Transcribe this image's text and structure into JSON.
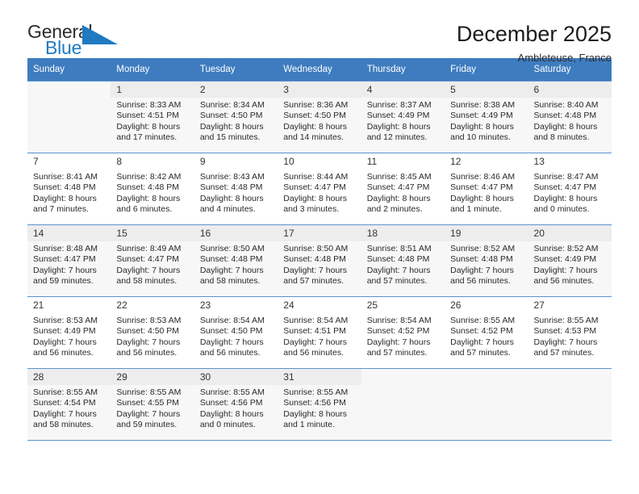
{
  "brand": {
    "name_part1": "General",
    "name_part2": "Blue",
    "logo_icon": "blue-triangle-icon",
    "colors": {
      "blue": "#1f7ac1",
      "dark": "#2b2b2b"
    }
  },
  "header": {
    "title": "December 2025",
    "subtitle": "Ambleteuse, France"
  },
  "colors": {
    "header_row_bg": "#3e7cbf",
    "grid_line": "#5b92cd",
    "shaded_row_bg": "#f7f7f7",
    "daynum_band_bg": "#ededed"
  },
  "calendar": {
    "weekday_headers": [
      "Sunday",
      "Monday",
      "Tuesday",
      "Wednesday",
      "Thursday",
      "Friday",
      "Saturday"
    ],
    "weeks": [
      {
        "shaded": true,
        "days": [
          {
            "day": "",
            "lines": []
          },
          {
            "day": "1",
            "lines": [
              "Sunrise: 8:33 AM",
              "Sunset: 4:51 PM",
              "Daylight: 8 hours",
              "and 17 minutes."
            ]
          },
          {
            "day": "2",
            "lines": [
              "Sunrise: 8:34 AM",
              "Sunset: 4:50 PM",
              "Daylight: 8 hours",
              "and 15 minutes."
            ]
          },
          {
            "day": "3",
            "lines": [
              "Sunrise: 8:36 AM",
              "Sunset: 4:50 PM",
              "Daylight: 8 hours",
              "and 14 minutes."
            ]
          },
          {
            "day": "4",
            "lines": [
              "Sunrise: 8:37 AM",
              "Sunset: 4:49 PM",
              "Daylight: 8 hours",
              "and 12 minutes."
            ]
          },
          {
            "day": "5",
            "lines": [
              "Sunrise: 8:38 AM",
              "Sunset: 4:49 PM",
              "Daylight: 8 hours",
              "and 10 minutes."
            ]
          },
          {
            "day": "6",
            "lines": [
              "Sunrise: 8:40 AM",
              "Sunset: 4:48 PM",
              "Daylight: 8 hours",
              "and 8 minutes."
            ]
          }
        ]
      },
      {
        "shaded": false,
        "days": [
          {
            "day": "7",
            "lines": [
              "Sunrise: 8:41 AM",
              "Sunset: 4:48 PM",
              "Daylight: 8 hours",
              "and 7 minutes."
            ]
          },
          {
            "day": "8",
            "lines": [
              "Sunrise: 8:42 AM",
              "Sunset: 4:48 PM",
              "Daylight: 8 hours",
              "and 6 minutes."
            ]
          },
          {
            "day": "9",
            "lines": [
              "Sunrise: 8:43 AM",
              "Sunset: 4:48 PM",
              "Daylight: 8 hours",
              "and 4 minutes."
            ]
          },
          {
            "day": "10",
            "lines": [
              "Sunrise: 8:44 AM",
              "Sunset: 4:47 PM",
              "Daylight: 8 hours",
              "and 3 minutes."
            ]
          },
          {
            "day": "11",
            "lines": [
              "Sunrise: 8:45 AM",
              "Sunset: 4:47 PM",
              "Daylight: 8 hours",
              "and 2 minutes."
            ]
          },
          {
            "day": "12",
            "lines": [
              "Sunrise: 8:46 AM",
              "Sunset: 4:47 PM",
              "Daylight: 8 hours",
              "and 1 minute."
            ]
          },
          {
            "day": "13",
            "lines": [
              "Sunrise: 8:47 AM",
              "Sunset: 4:47 PM",
              "Daylight: 8 hours",
              "and 0 minutes."
            ]
          }
        ]
      },
      {
        "shaded": true,
        "days": [
          {
            "day": "14",
            "lines": [
              "Sunrise: 8:48 AM",
              "Sunset: 4:47 PM",
              "Daylight: 7 hours",
              "and 59 minutes."
            ]
          },
          {
            "day": "15",
            "lines": [
              "Sunrise: 8:49 AM",
              "Sunset: 4:47 PM",
              "Daylight: 7 hours",
              "and 58 minutes."
            ]
          },
          {
            "day": "16",
            "lines": [
              "Sunrise: 8:50 AM",
              "Sunset: 4:48 PM",
              "Daylight: 7 hours",
              "and 58 minutes."
            ]
          },
          {
            "day": "17",
            "lines": [
              "Sunrise: 8:50 AM",
              "Sunset: 4:48 PM",
              "Daylight: 7 hours",
              "and 57 minutes."
            ]
          },
          {
            "day": "18",
            "lines": [
              "Sunrise: 8:51 AM",
              "Sunset: 4:48 PM",
              "Daylight: 7 hours",
              "and 57 minutes."
            ]
          },
          {
            "day": "19",
            "lines": [
              "Sunrise: 8:52 AM",
              "Sunset: 4:48 PM",
              "Daylight: 7 hours",
              "and 56 minutes."
            ]
          },
          {
            "day": "20",
            "lines": [
              "Sunrise: 8:52 AM",
              "Sunset: 4:49 PM",
              "Daylight: 7 hours",
              "and 56 minutes."
            ]
          }
        ]
      },
      {
        "shaded": false,
        "days": [
          {
            "day": "21",
            "lines": [
              "Sunrise: 8:53 AM",
              "Sunset: 4:49 PM",
              "Daylight: 7 hours",
              "and 56 minutes."
            ]
          },
          {
            "day": "22",
            "lines": [
              "Sunrise: 8:53 AM",
              "Sunset: 4:50 PM",
              "Daylight: 7 hours",
              "and 56 minutes."
            ]
          },
          {
            "day": "23",
            "lines": [
              "Sunrise: 8:54 AM",
              "Sunset: 4:50 PM",
              "Daylight: 7 hours",
              "and 56 minutes."
            ]
          },
          {
            "day": "24",
            "lines": [
              "Sunrise: 8:54 AM",
              "Sunset: 4:51 PM",
              "Daylight: 7 hours",
              "and 56 minutes."
            ]
          },
          {
            "day": "25",
            "lines": [
              "Sunrise: 8:54 AM",
              "Sunset: 4:52 PM",
              "Daylight: 7 hours",
              "and 57 minutes."
            ]
          },
          {
            "day": "26",
            "lines": [
              "Sunrise: 8:55 AM",
              "Sunset: 4:52 PM",
              "Daylight: 7 hours",
              "and 57 minutes."
            ]
          },
          {
            "day": "27",
            "lines": [
              "Sunrise: 8:55 AM",
              "Sunset: 4:53 PM",
              "Daylight: 7 hours",
              "and 57 minutes."
            ]
          }
        ]
      },
      {
        "shaded": true,
        "days": [
          {
            "day": "28",
            "lines": [
              "Sunrise: 8:55 AM",
              "Sunset: 4:54 PM",
              "Daylight: 7 hours",
              "and 58 minutes."
            ]
          },
          {
            "day": "29",
            "lines": [
              "Sunrise: 8:55 AM",
              "Sunset: 4:55 PM",
              "Daylight: 7 hours",
              "and 59 minutes."
            ]
          },
          {
            "day": "30",
            "lines": [
              "Sunrise: 8:55 AM",
              "Sunset: 4:56 PM",
              "Daylight: 8 hours",
              "and 0 minutes."
            ]
          },
          {
            "day": "31",
            "lines": [
              "Sunrise: 8:55 AM",
              "Sunset: 4:56 PM",
              "Daylight: 8 hours",
              "and 1 minute."
            ]
          },
          {
            "day": "",
            "lines": []
          },
          {
            "day": "",
            "lines": []
          },
          {
            "day": "",
            "lines": []
          }
        ]
      }
    ]
  }
}
